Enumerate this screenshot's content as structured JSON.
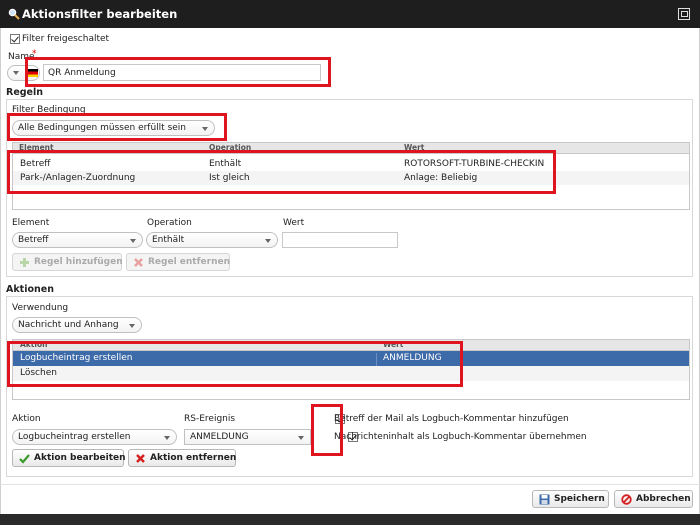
{
  "window": {
    "title": "Aktionsfilter bearbeiten"
  },
  "filter_enabled": {
    "label": "Filter freigeschaltet",
    "checked": true
  },
  "name": {
    "label": "Name",
    "required_mark": "*",
    "value": "QR Anmeldung"
  },
  "rules": {
    "section_title": "Regeln",
    "condition_label": "Filter Bedingung",
    "condition_value": "Alle Bedingungen müssen erfüllt sein",
    "columns": [
      "Element",
      "Operation",
      "Wert"
    ],
    "rows": [
      {
        "element": "Betreff",
        "operation": "Enthält",
        "value": "ROTORSOFT-TURBINE-CHECKIN"
      },
      {
        "element": "Park-/Anlagen-Zuordnung",
        "operation": "Ist gleich",
        "value": "Anlage: Beliebig"
      }
    ],
    "element_label": "Element",
    "element_value": "Betreff",
    "operation_label": "Operation",
    "operation_value": "Enthält",
    "wert_label": "Wert",
    "wert_value": "",
    "add_button": "Regel hinzufügen",
    "remove_button": "Regel entfernen"
  },
  "actions": {
    "section_title": "Aktionen",
    "usage_label": "Verwendung",
    "usage_value": "Nachricht und Anhang",
    "columns": [
      "Aktion",
      "Wert"
    ],
    "rows": [
      {
        "action": "Logbucheintrag erstellen",
        "value": "ANMELDUNG",
        "selected": true
      },
      {
        "action": "Löschen",
        "value": "",
        "selected": false
      }
    ],
    "action_label": "Aktion",
    "action_value": "Logbucheintrag erstellen",
    "event_label": "RS-Ereignis",
    "event_value": "ANMELDUNG",
    "option1": {
      "label": "Betreff der Mail als Logbuch-Kommentar hinzufügen",
      "checked": true
    },
    "option2": {
      "label": "Nachrichteninhalt als Logbuch-Kommentar übernehmen",
      "checked": true
    },
    "edit_button": "Aktion bearbeiten",
    "remove_button": "Aktion entfernen"
  },
  "footer": {
    "save_button": "Speichern",
    "cancel_button": "Abbrechen"
  },
  "colors": {
    "highlight": "#e0141e",
    "selection": "#3d6aa8",
    "titlebar": "#1e1e1e"
  }
}
